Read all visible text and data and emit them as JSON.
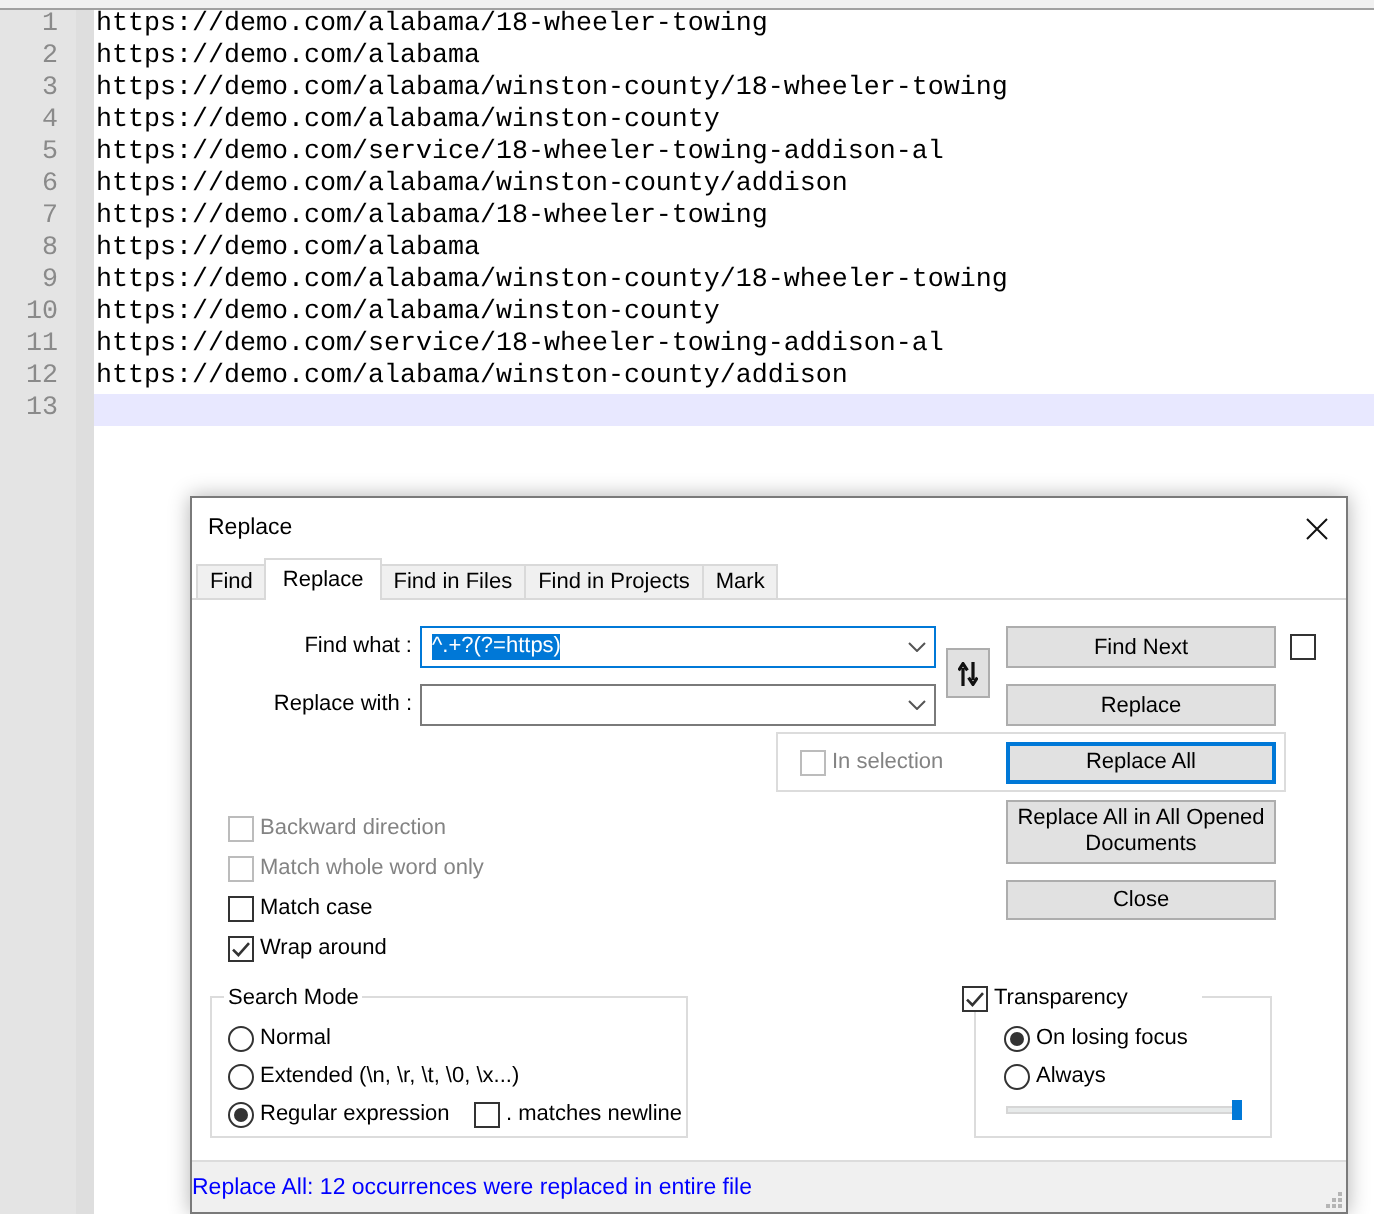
{
  "editor": {
    "lines": [
      {
        "number": "1",
        "text": "https://demo.com/alabama/18-wheeler-towing",
        "current": false
      },
      {
        "number": "2",
        "text": "https://demo.com/alabama",
        "current": false
      },
      {
        "number": "3",
        "text": "https://demo.com/alabama/winston-county/18-wheeler-towing",
        "current": false
      },
      {
        "number": "4",
        "text": "https://demo.com/alabama/winston-county",
        "current": false
      },
      {
        "number": "5",
        "text": "https://demo.com/service/18-wheeler-towing-addison-al",
        "current": false
      },
      {
        "number": "6",
        "text": "https://demo.com/alabama/winston-county/addison",
        "current": false
      },
      {
        "number": "7",
        "text": "https://demo.com/alabama/18-wheeler-towing",
        "current": false
      },
      {
        "number": "8",
        "text": "https://demo.com/alabama",
        "current": false
      },
      {
        "number": "9",
        "text": "https://demo.com/alabama/winston-county/18-wheeler-towing",
        "current": false
      },
      {
        "number": "10",
        "text": "https://demo.com/alabama/winston-county",
        "current": false
      },
      {
        "number": "11",
        "text": "https://demo.com/service/18-wheeler-towing-addison-al",
        "current": false
      },
      {
        "number": "12",
        "text": "https://demo.com/alabama/winston-county/addison",
        "current": false
      },
      {
        "number": "13",
        "current": true
      }
    ]
  },
  "dialog": {
    "title": "Replace",
    "tabs": [
      {
        "label": "Find",
        "selected": false
      },
      {
        "label": "Replace",
        "selected": true
      },
      {
        "label": "Find in Files",
        "selected": false
      },
      {
        "label": "Find in Projects",
        "selected": false
      },
      {
        "label": "Mark",
        "selected": false
      }
    ],
    "fields": [
      {
        "label": "Find what :",
        "value": "^.+?(?=https)",
        "focused": true,
        "text_selected": true
      },
      {
        "label": "Replace with :",
        "focused": false
      }
    ],
    "buttons": [
      {
        "label": "Find Next",
        "focused": false
      },
      {
        "label": "Replace",
        "focused": false
      },
      {
        "label": "Replace All",
        "focused": true
      },
      {
        "label": "Replace All in All Opened Documents",
        "focused": false
      },
      {
        "label": "Close",
        "focused": false
      }
    ],
    "side_checkbox": {
      "checked": false
    },
    "in_selection": {
      "label": "In selection",
      "checked": false,
      "disabled": true
    },
    "options": [
      {
        "label": "Backward direction",
        "checked": false,
        "disabled": true
      },
      {
        "label": "Match whole word only",
        "checked": false,
        "disabled": true
      },
      {
        "label": "Match case",
        "checked": false,
        "disabled": false
      },
      {
        "label": "Wrap around",
        "checked": true,
        "disabled": false
      }
    ],
    "search_mode": {
      "title": "Search Mode",
      "modes": [
        {
          "label": "Normal",
          "selected": false
        },
        {
          "label": "Extended (\\n, \\r, \\t, \\0, \\x...)",
          "selected": false
        },
        {
          "label": "Regular expression",
          "selected": true
        }
      ],
      "matches_newline": {
        "label": ". matches newline",
        "checked": false
      }
    },
    "transparency": {
      "label": "Transparency",
      "checked": true,
      "modes": [
        {
          "label": "On losing focus",
          "selected": true
        },
        {
          "label": "Always",
          "selected": false
        }
      ],
      "slider": {
        "level": 1
      }
    },
    "status": "Replace All: 12 occurrences were replaced in entire file"
  }
}
